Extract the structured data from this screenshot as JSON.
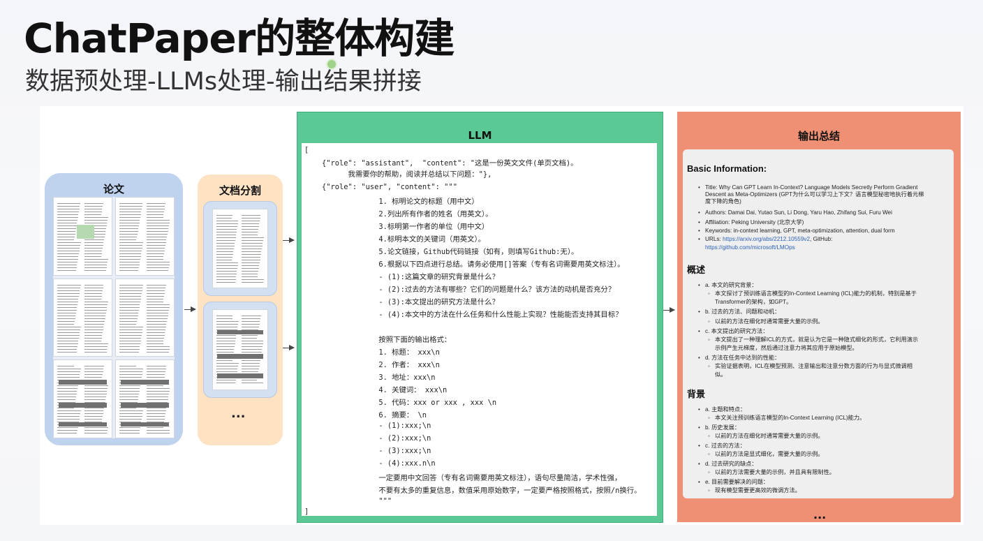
{
  "slide": {
    "title": "ChatPaper的整体构建",
    "subtitle": "数据预处理-LLMs处理-输出结果拼接"
  },
  "paper_panel": {
    "label": "论文"
  },
  "split_panel": {
    "label": "文档分割",
    "ellipsis": "..."
  },
  "llm_panel": {
    "label": "LLM",
    "lines": [
      "[",
      "    {\"role\": \"assistant\",  \"content\": \"这是一份英文文件(单页文档)。",
      "          我需要你的帮助，阅读并总结以下问题：\"},",
      "    {\"role\": \"user\", \"content\": \"\"\"",
      "                 1. 标明论文的标题（用中文）",
      "                 2.列出所有作者的姓名（用英文）。",
      "                 3.标明第一作者的单位（用中文）",
      "                 4.标明本文的关键词（用英文）。",
      "                 5.论文链接，Github代码链接（如有，则填写Github:无）。",
      "                 6.根据以下四点进行总结。请务必使用[]答案（专有名词需要用英文标注）。",
      "                 - (1):这篇文章的研究背景是什么？",
      "                 - (2):过去的方法有哪些？它们的问题是什么？该方法的动机是否充分？",
      "                 - (3):本文提出的研究方法是什么？",
      "                 - (4):本文中的方法在什么任务和什么性能上实现？性能能否支持其目标？",
      "",
      "                 按照下面的输出格式：",
      "                 1. 标题： xxx\\n",
      "                 2. 作者： xxx\\n",
      "                 3. 地址：xxx\\n",
      "                 4. 关键词： xxx\\n",
      "                 5. 代码：xxx or xxx , xxx \\n",
      "                 6. 摘要： \\n",
      "                 - (1):xxx;\\n",
      "                 - (2):xxx;\\n",
      "                 - (3):xxx;\\n",
      "                 - (4):xxx.n\\n",
      "                 一定要用中文回答（专有名词需要用英文标注），语句尽量简洁，学术性强，",
      "                 不要有太多的重复信息，数值采用原始数字，一定要严格按照格式，按照/n换行。",
      "                 \"\"\"",
      "]"
    ]
  },
  "output_panel": {
    "label": "输出总结",
    "basic_heading": "Basic Information:",
    "basic_items": [
      "Title: Why Can GPT Learn In-Context? Language Models Secretly Perform Gradient",
      "Descent as Meta-Optimizers (GPT为什么可以学习上下文？语言模型秘密地执行着元梯",
      "度下降的角色)",
      "Authors: Damai Dai, Yutao Sun, Li Dong, Yaru Hao, Zhifang Sui, Furu Wei",
      "Affiliation: Peking University (北京大学)",
      "Keywords: in-context learning, GPT, meta-optimization, attention, dual form",
      "URLs: ",
      "https://github.com/microsoft/LMOps"
    ],
    "url_link": "https://arxiv.org/abs/2212.10559v2",
    "url_suffix": ", GitHub:",
    "overview_heading": "概述",
    "overview_items": [
      "a. 本文的研究背景：",
      "本文探讨了预训练语言模型的In-Context Learning (ICL)能力的机制，特别是基于",
      "Transformer的架构，如GPT。",
      "b. 过去的方法、问题和动机：",
      "以前的方法在细化时通常需要大量的示例。",
      "c. 本文提出的研究方法：",
      "本文提出了一种理解ICL的方式，就是认为它是一种隐式细化的形式，它利用演示",
      "示例产生元梯度，然后通过注意力将其应用于原始模型。",
      "d. 方法在任务中达到的性能：",
      "实验证据表明，ICL在模型预测、注意输出和注意分数方面的行为与显式微调相",
      "似。"
    ],
    "background_heading": "背景",
    "background_items": [
      "a. 主题和特点：",
      "本文关注预训练语言模型的In-Context Learning (ICL)能力。",
      "b. 历史发展：",
      "以前的方法在细化时通常需要大量的示例。",
      "c. 过去的方法：",
      "以前的方法是显式细化，需要大量的示例。",
      "d. 过去研究的缺点：",
      "以前的方法需要大量的示例，并且具有限制性。",
      "e. 目前需要解决的问题：",
      "现有模型需要更高效的微调方法。"
    ],
    "ellipsis": "..."
  }
}
